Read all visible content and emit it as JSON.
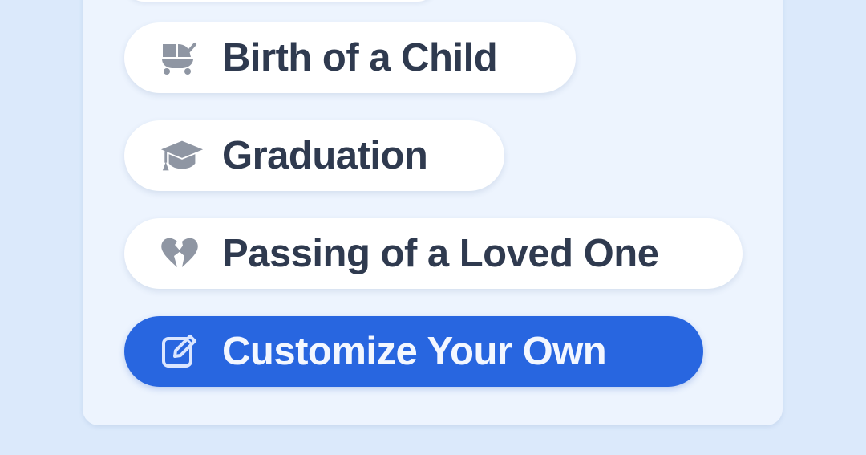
{
  "options": [
    {
      "label": "Birth of a Child",
      "icon": "baby-carriage-icon",
      "selected": false
    },
    {
      "label": "Graduation",
      "icon": "graduation-cap-icon",
      "selected": false
    },
    {
      "label": "Passing of a Loved One",
      "icon": "broken-heart-icon",
      "selected": false
    },
    {
      "label": "Customize Your Own",
      "icon": "edit-icon",
      "selected": true
    }
  ],
  "colors": {
    "page_background": "#dbe9fb",
    "panel_background": "#edf4fe",
    "option_background": "#ffffff",
    "option_text": "#2f3a4f",
    "icon_gray": "#8f96a3",
    "primary": "#2866e0",
    "primary_text": "#f3f7ff"
  }
}
